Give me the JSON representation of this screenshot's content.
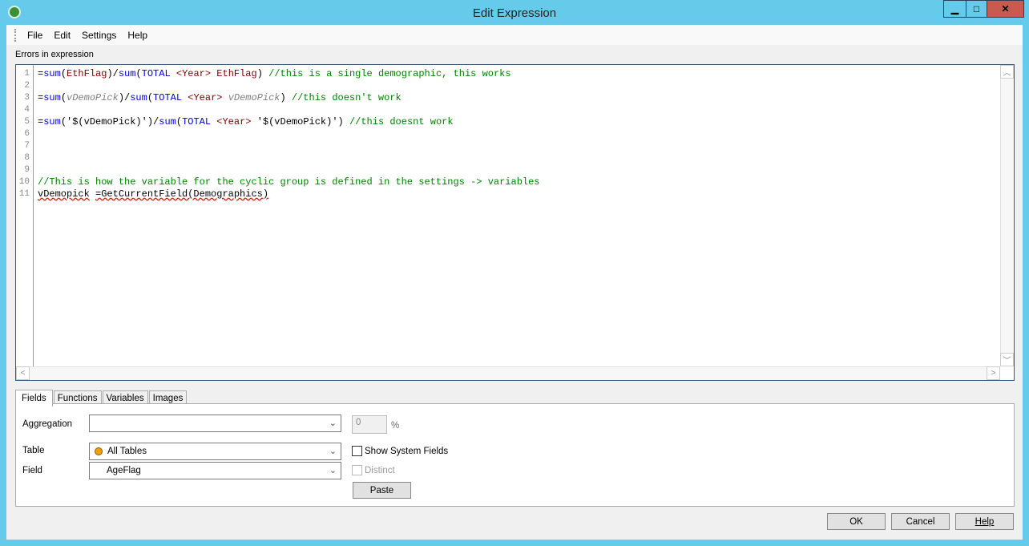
{
  "window": {
    "title": "Edit Expression",
    "minimize": "▁",
    "maximize": "□",
    "close": "✕"
  },
  "menu": [
    "File",
    "Edit",
    "Settings",
    "Help"
  ],
  "editor": {
    "status_label": "Errors in expression",
    "line_numbers": [
      "1",
      "2",
      "3",
      "4",
      "5",
      "6",
      "7",
      "8",
      "9",
      "10",
      "11"
    ],
    "lines": [
      [
        [
          "op",
          "="
        ],
        [
          "fn",
          "sum"
        ],
        [
          "op",
          "("
        ],
        [
          "field",
          "EthFlag"
        ],
        [
          "op",
          ")/"
        ],
        [
          "fn",
          "sum"
        ],
        [
          "op",
          "("
        ],
        [
          "kw",
          "TOTAL"
        ],
        [
          "op",
          " "
        ],
        [
          "field",
          "<Year>"
        ],
        [
          "op",
          " "
        ],
        [
          "field",
          "EthFlag"
        ],
        [
          "op",
          ") "
        ],
        [
          "cm",
          "//this is a single demographic, this works"
        ]
      ],
      [],
      [
        [
          "op",
          "="
        ],
        [
          "fn",
          "sum"
        ],
        [
          "op",
          "("
        ],
        [
          "var",
          "vDemoPick"
        ],
        [
          "op",
          ")/"
        ],
        [
          "fn",
          "sum"
        ],
        [
          "op",
          "("
        ],
        [
          "kw",
          "TOTAL"
        ],
        [
          "op",
          " "
        ],
        [
          "field",
          "<Year>"
        ],
        [
          "op",
          " "
        ],
        [
          "var",
          "vDemoPick"
        ],
        [
          "op",
          ") "
        ],
        [
          "cm",
          "//this doesn't work"
        ]
      ],
      [],
      [
        [
          "op",
          "="
        ],
        [
          "fn",
          "sum"
        ],
        [
          "op",
          "("
        ],
        [
          "str",
          "'$(vDemoPick)'"
        ],
        [
          "op",
          ")/"
        ],
        [
          "fn",
          "sum"
        ],
        [
          "op",
          "("
        ],
        [
          "kw",
          "TOTAL"
        ],
        [
          "op",
          " "
        ],
        [
          "field",
          "<Year>"
        ],
        [
          "op",
          " "
        ],
        [
          "str",
          "'$(vDemoPick)'"
        ],
        [
          "op",
          ") "
        ],
        [
          "cm",
          "//this doesnt work"
        ]
      ],
      [],
      [],
      [],
      [],
      [
        [
          "cm",
          "//This is how the variable for the cyclic group is defined in the settings -> variables"
        ]
      ],
      [
        [
          "err",
          "vDemopick"
        ],
        [
          "op",
          " "
        ],
        [
          "err",
          "=GetCurrentField(Demographics)"
        ]
      ]
    ]
  },
  "tabs": [
    {
      "label": "Fields",
      "active": true
    },
    {
      "label": "Functions"
    },
    {
      "label": "Variables"
    },
    {
      "label": "Images"
    }
  ],
  "fields": {
    "aggregation_label": "Aggregation",
    "aggregation_value": "",
    "percent_value": "0",
    "percent_symbol": "%",
    "table_label": "Table",
    "table_value": "All Tables",
    "field_label": "Field",
    "field_value": "AgeFlag",
    "show_system_fields": "Show System Fields",
    "distinct": "Distinct",
    "paste": "Paste"
  },
  "buttons": {
    "ok": "OK",
    "cancel": "Cancel",
    "help": "Help"
  }
}
